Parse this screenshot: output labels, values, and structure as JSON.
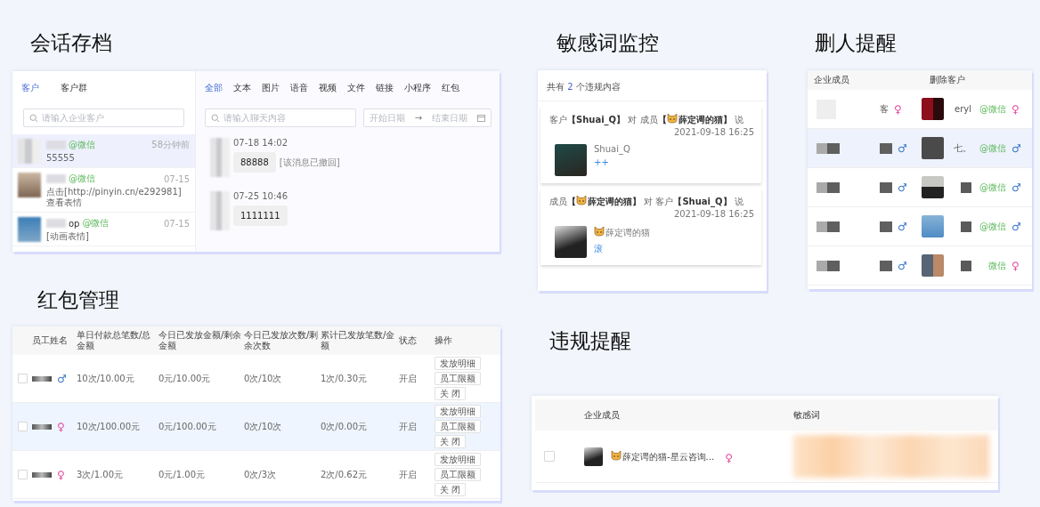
{
  "chat_archive": {
    "title": "会话存档",
    "customer_tabs": [
      {
        "label": "客户",
        "selected": true
      },
      {
        "label": "客户群",
        "selected": false
      }
    ],
    "customer_search": {
      "placeholder": "请输入企业客户"
    },
    "type_tabs": [
      {
        "label": "全部",
        "selected": true
      },
      {
        "label": "文本",
        "selected": false
      },
      {
        "label": "图片",
        "selected": false
      },
      {
        "label": "语音",
        "selected": false
      },
      {
        "label": "视频",
        "selected": false
      },
      {
        "label": "文件",
        "selected": false
      },
      {
        "label": "链接",
        "selected": false
      },
      {
        "label": "小程序",
        "selected": false
      },
      {
        "label": "红包",
        "selected": false
      }
    ],
    "message_search": {
      "placeholder": "请输入聊天内容"
    },
    "date_range": {
      "start": "开始日期",
      "separator": "→",
      "end": "结束日期"
    },
    "conversations": [
      {
        "tag": "@微信",
        "preview": "55555",
        "time": "58分钟前",
        "selected": true
      },
      {
        "tag": "@微信",
        "preview": "点击[http://pinyin.cn/e292981]查看表情",
        "time": "07-15",
        "selected": false
      },
      {
        "name": "op",
        "tag": "@微信",
        "preview": "[动画表情]",
        "time": "07-15",
        "selected": false
      }
    ],
    "messages": [
      {
        "time": "07-18 14:02",
        "text": "88888",
        "note": "[该消息已撤回]"
      },
      {
        "time": "07-25 10:46",
        "text": "1111111"
      }
    ]
  },
  "sensitive_monitor": {
    "title": "敏感词监控",
    "summary_prefix": "共有",
    "count": "2",
    "summary_suffix": "个违规内容",
    "items": [
      {
        "from": {
          "role": "客户",
          "open": "【",
          "name": "Shuai_Q",
          "close": "】",
          "kind": "customer"
        },
        "connector": "对",
        "to": {
          "role": "成员",
          "open": "【",
          "name": "薛定谔的猫",
          "close": "】",
          "kind": "member"
        },
        "verb": "说",
        "time": "2021-09-18 16:25",
        "sender": {
          "name": "Shuai_Q",
          "kind": "customer"
        },
        "message": "++"
      },
      {
        "from": {
          "role": "成员",
          "open": "【",
          "name": "薛定谔的猫",
          "close": "】",
          "kind": "member"
        },
        "connector": "对",
        "to": {
          "role": "客户",
          "open": "【",
          "name": "Shuai_Q",
          "close": "】",
          "kind": "customer"
        },
        "verb": "说",
        "time": "2021-09-18 16:25",
        "sender": {
          "name": "薛定谔的猫",
          "kind": "member"
        },
        "message": "滚"
      }
    ]
  },
  "delete_reminder": {
    "title": "删人提醒",
    "columns": [
      "企业成员",
      "删除客户"
    ],
    "rows": [
      {
        "member": "客",
        "member_gender": {
          "symbol": "♀",
          "color": "#e0479a"
        },
        "customer": "eryl",
        "tag": "@微信",
        "customer_gender": {
          "symbol": "♀",
          "color": "#e0479a"
        },
        "selected": false
      },
      {
        "member_gender": {
          "symbol": "♂",
          "color": "#3a78c9"
        },
        "customer": "七。",
        "tag": "@微信",
        "customer_gender": {
          "symbol": "♂",
          "color": "#3a78c9"
        },
        "selected": true
      },
      {
        "member_gender": {
          "symbol": "♂",
          "color": "#3a78c9"
        },
        "tag": "@微信",
        "customer_gender": {
          "symbol": "♂",
          "color": "#3a78c9"
        },
        "selected": false
      },
      {
        "member_gender": {
          "symbol": "♂",
          "color": "#3a78c9"
        },
        "tag": "@微信",
        "customer_gender": {
          "symbol": "♂",
          "color": "#3a78c9"
        },
        "selected": false
      },
      {
        "member_gender": {
          "symbol": "♂",
          "color": "#3a78c9"
        },
        "tag": "微信",
        "customer_gender": {
          "symbol": "♀",
          "color": "#e0479a"
        },
        "selected": false
      }
    ]
  },
  "red_packet": {
    "title": "红包管理",
    "columns": [
      "员工姓名",
      "单日付款总笔数/总金额",
      "今日已发放金额/剩余金额",
      "今日已发放次数/剩余次数",
      "累计已发放笔数/金额",
      "状态",
      "操作"
    ],
    "rows": [
      {
        "gender": {
          "symbol": "♂",
          "color": "#3a78c9"
        },
        "daily": "10次/10.00元",
        "today_amount": "0元/10.00元",
        "today_count": "0次/10次",
        "total": "1次/0.30元",
        "status": "开启",
        "actions": [
          "发放明细",
          "员工限额",
          "关 闭"
        ],
        "checked": false,
        "selected": false
      },
      {
        "gender": {
          "symbol": "♀",
          "color": "#e0479a"
        },
        "daily": "10次/100.00元",
        "today_amount": "0元/100.00元",
        "today_count": "0次/10次",
        "total": "0次/0.00元",
        "status": "开启",
        "actions": [
          "发放明细",
          "员工限额",
          "关 闭"
        ],
        "checked": false,
        "selected": true
      },
      {
        "gender": {
          "symbol": "♀",
          "color": "#e0479a"
        },
        "daily": "3次/1.00元",
        "today_amount": "0元/1.00元",
        "today_count": "0次/3次",
        "total": "2次/0.62元",
        "status": "开启",
        "actions": [
          "发放明细",
          "员工限额",
          "关 闭"
        ],
        "checked": false,
        "selected": false
      }
    ]
  },
  "violation": {
    "title": "违规提醒",
    "columns": [
      "企业成员",
      "敏感词"
    ],
    "rows": [
      {
        "member": "薛定谔的猫-星云咨询...",
        "kind": "member",
        "gender": {
          "symbol": "♀",
          "color": "#e0479a"
        },
        "checked": false
      }
    ]
  }
}
